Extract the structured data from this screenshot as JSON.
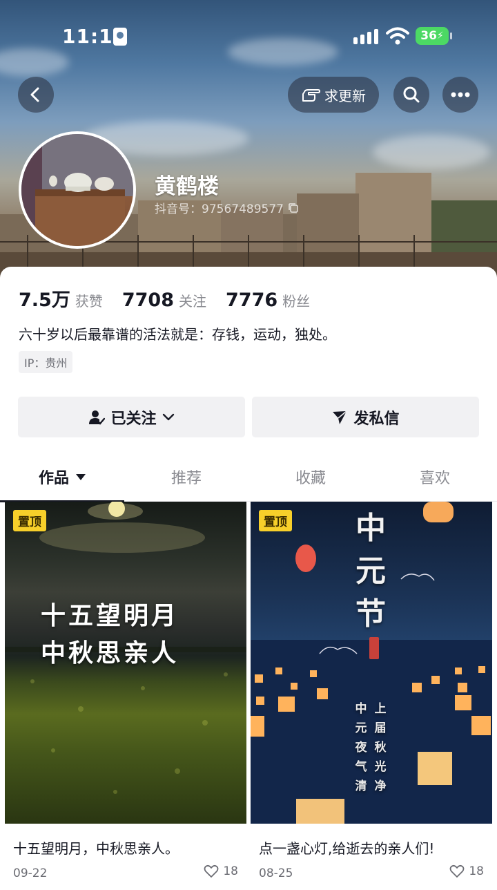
{
  "status_bar": {
    "time": "11:13",
    "battery": "36"
  },
  "header": {
    "request_update_label": "求更新",
    "icons": {
      "back": "back-arrow-icon",
      "request": "pointing-hand-icon",
      "search": "search-icon",
      "more": "more-dots-icon"
    }
  },
  "profile": {
    "name": "黄鹤楼",
    "douyin_id": "抖音号：97567489577"
  },
  "stats": [
    {
      "value": "7.5万",
      "label": "获赞"
    },
    {
      "value": "7708",
      "label": "关注"
    },
    {
      "value": "7776",
      "label": "粉丝"
    }
  ],
  "bio": "六十岁以后最靠谱的活法就是：存钱，运动，独处。",
  "ip": "IP：贵州",
  "buttons": {
    "follow": "已关注",
    "message": "发私信"
  },
  "tabs": [
    "作品",
    "推荐",
    "收藏",
    "喜欢"
  ],
  "videos": [
    {
      "pinned_label": "置顶",
      "overlay_lines": [
        "十五望明月",
        "中秋思亲人"
      ],
      "title": "十五望明月，中秋思亲人。",
      "date": "09-22",
      "likes": "18"
    },
    {
      "pinned_label": "置顶",
      "overlay_big": "中元节",
      "overlay_poem": [
        "上届秋光净",
        "中元夜气清"
      ],
      "title": "点一盏心灯,给逝去的亲人们!",
      "date": "08-25",
      "likes": "18"
    }
  ],
  "colors": {
    "pin_badge": "#f7cf2a",
    "battery": "#4cd964",
    "text_primary": "#161823",
    "text_secondary": "#8a8b91"
  }
}
